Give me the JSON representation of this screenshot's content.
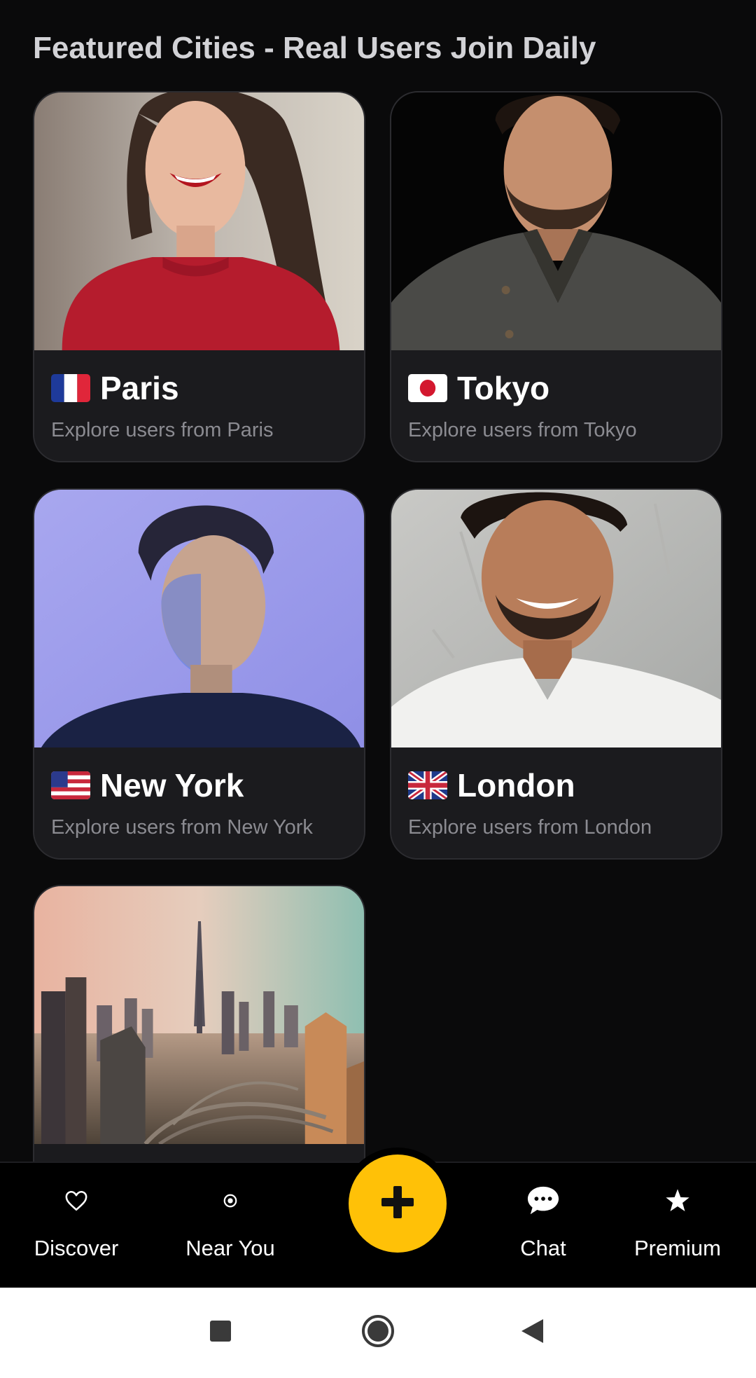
{
  "section": {
    "title": "Featured Cities - Real Users Join Daily"
  },
  "cities": [
    {
      "name": "Paris",
      "subtitle": "Explore users from Paris",
      "flag": "france-flag-icon"
    },
    {
      "name": "Tokyo",
      "subtitle": "Explore users from Tokyo",
      "flag": "japan-flag-icon"
    },
    {
      "name": "New York",
      "subtitle": "Explore users from New York",
      "flag": "usa-flag-icon"
    },
    {
      "name": "London",
      "subtitle": "Explore users from London",
      "flag": "uk-flag-icon"
    },
    {
      "name": "",
      "subtitle": "",
      "flag": ""
    }
  ],
  "bottom_nav": {
    "items": [
      {
        "label": "Discover",
        "icon": "heart-outline-icon"
      },
      {
        "label": "Near You",
        "icon": "location-target-icon"
      },
      {
        "label": "Chat",
        "icon": "chat-bubble-icon"
      },
      {
        "label": "Premium",
        "icon": "star-icon"
      }
    ],
    "fab_icon": "plus-icon"
  },
  "system_nav": {
    "icons": [
      "recents-square-icon",
      "home-circle-icon",
      "back-triangle-icon"
    ]
  },
  "colors": {
    "background": "#0a0a0b",
    "card": "#1b1b1e",
    "accent": "#ffc107",
    "subtitle": "#8b8b91"
  }
}
